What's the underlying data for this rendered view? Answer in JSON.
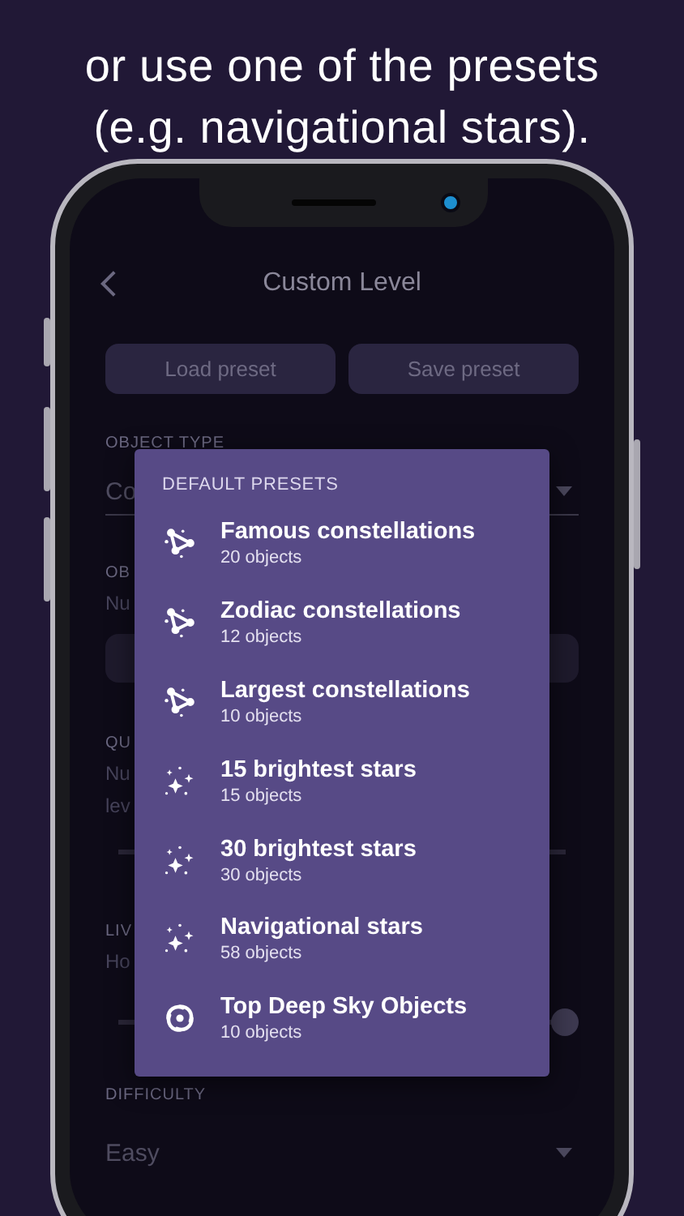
{
  "headline": [
    "or use one of the presets",
    "(e.g. navigational stars)."
  ],
  "header": {
    "title": "Custom Level"
  },
  "buttons": [
    "Load preset",
    "Save preset"
  ],
  "background": {
    "object_type_label": "OBJECT TYPE",
    "object_type_value": "Co",
    "objects_label": "OB",
    "objects_hint": "Nu",
    "questions_label": "QU",
    "questions_hint": [
      "Nu",
      "lev"
    ],
    "lives_label": "LIV",
    "lives_hint": "Ho",
    "lives_slider": {
      "level": 1
    },
    "difficulty_label": "DIFFICULTY",
    "difficulty_value": "Easy"
  },
  "popup": {
    "title": "DEFAULT PRESETS",
    "items": [
      {
        "kind": "constellation",
        "name": "Famous constellations",
        "count": "20 objects"
      },
      {
        "kind": "constellation",
        "name": "Zodiac constellations",
        "count": "12 objects"
      },
      {
        "kind": "constellation",
        "name": "Largest constellations",
        "count": "10 objects"
      },
      {
        "kind": "stars",
        "name": "15 brightest stars",
        "count": "15 objects"
      },
      {
        "kind": "stars",
        "name": "30 brightest stars",
        "count": "30 objects"
      },
      {
        "kind": "stars",
        "name": "Navigational stars",
        "count": "58 objects"
      },
      {
        "kind": "galaxy",
        "name": "Top Deep Sky Objects",
        "count": "10 objects"
      }
    ]
  }
}
